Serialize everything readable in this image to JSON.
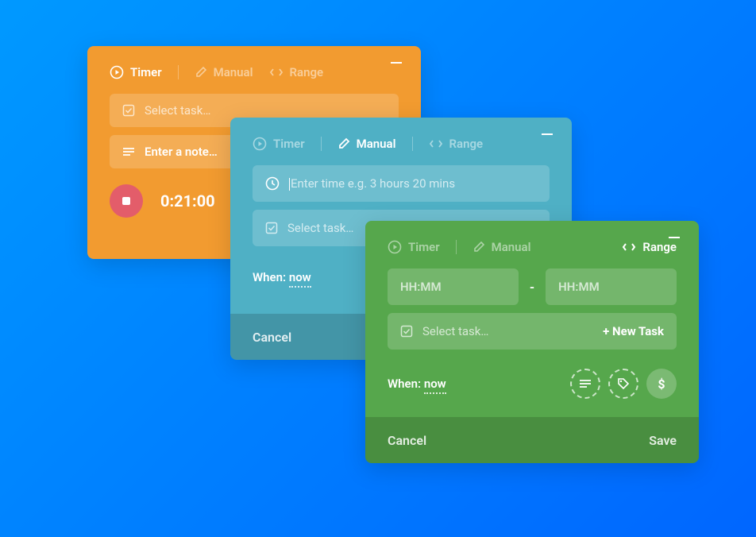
{
  "tabs": {
    "timer": "Timer",
    "manual": "Manual",
    "range": "Range"
  },
  "orange": {
    "selectTask": "Select task…",
    "enterNote": "Enter a note…",
    "timerValue": "0:21:00"
  },
  "teal": {
    "enterTime": "Enter time e.g. 3 hours 20 mins",
    "selectTask": "Select task…",
    "whenLabel": "When:",
    "whenValue": "now",
    "cancel": "Cancel"
  },
  "green": {
    "hhmm": "HH:MM",
    "dash": "-",
    "selectTask": "Select task…",
    "newTask": "+ New Task",
    "whenLabel": "When:",
    "whenValue": "now",
    "dollar": "$",
    "cancel": "Cancel",
    "save": "Save"
  }
}
